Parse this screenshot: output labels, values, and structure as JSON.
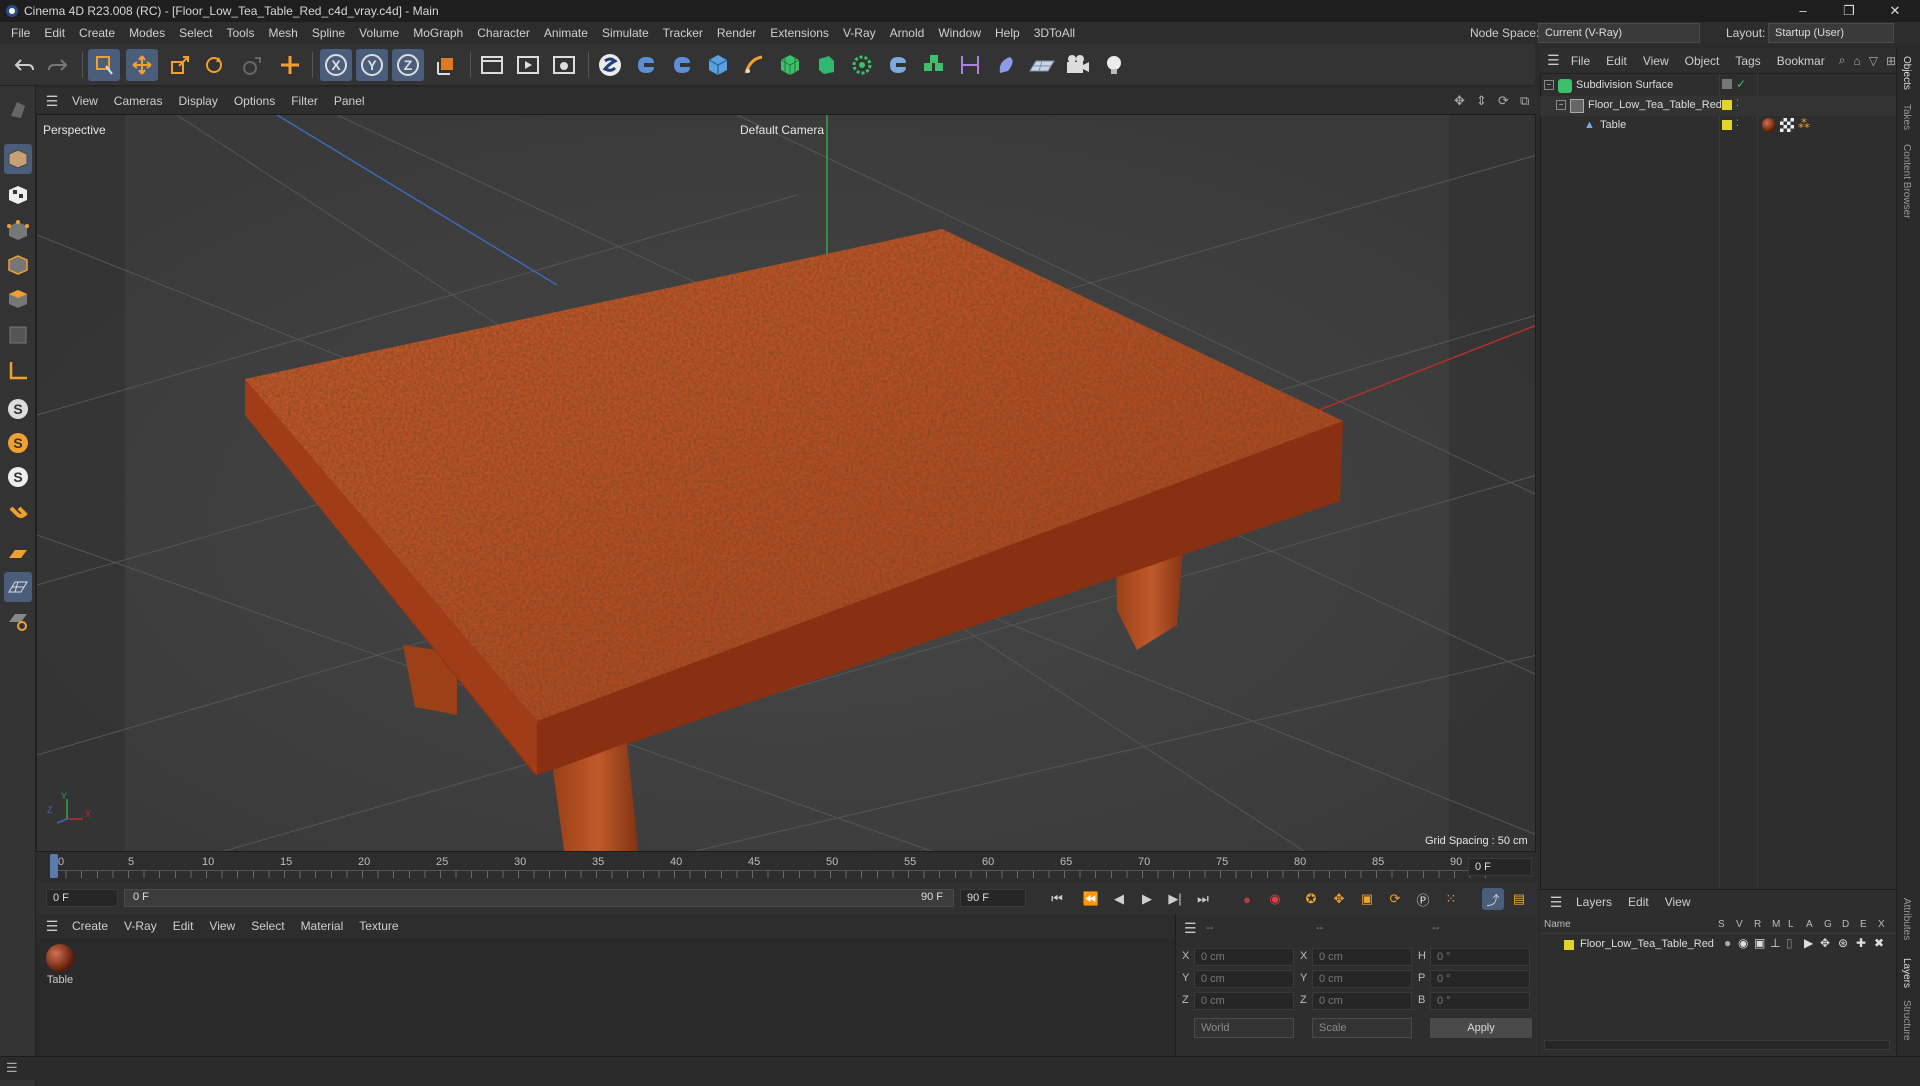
{
  "window": {
    "title": "Cinema 4D R23.008 (RC) - [Floor_Low_Tea_Table_Red_c4d_vray.c4d] - Main",
    "min": "–",
    "restore": "❐",
    "close": "✕"
  },
  "menu": [
    "File",
    "Edit",
    "Create",
    "Modes",
    "Select",
    "Tools",
    "Mesh",
    "Spline",
    "Volume",
    "MoGraph",
    "Character",
    "Animate",
    "Simulate",
    "Tracker",
    "Render",
    "Extensions",
    "V-Ray",
    "Arnold",
    "Window",
    "Help",
    "3DToAll"
  ],
  "nodespace": {
    "label": "Node Space:",
    "value": "Current (V-Ray)"
  },
  "layout": {
    "label": "Layout:",
    "value": "Startup (User)"
  },
  "viewport": {
    "menu": [
      "View",
      "Cameras",
      "Display",
      "Options",
      "Filter",
      "Panel"
    ],
    "name": "Perspective",
    "camera": "Default Camera",
    "grid": "Grid Spacing : 50 cm",
    "axis": {
      "y": "Y",
      "z": "Z",
      "x": "X"
    }
  },
  "timeline": {
    "ticks": [
      "0",
      "5",
      "10",
      "15",
      "20",
      "25",
      "30",
      "35",
      "40",
      "45",
      "50",
      "55",
      "60",
      "65",
      "70",
      "75",
      "80",
      "85",
      "90"
    ],
    "current": "0 F"
  },
  "transport": {
    "start": "0 F",
    "slider_start": "0 F",
    "slider_end": "90 F",
    "end": "90 F"
  },
  "material_manager": {
    "menu": [
      "Create",
      "V-Ray",
      "Edit",
      "View",
      "Select",
      "Material",
      "Texture"
    ],
    "materials": [
      {
        "name": "Table"
      }
    ]
  },
  "coords": {
    "header": [
      "--",
      "--",
      "--"
    ],
    "rows": [
      {
        "a": "X",
        "av": "0 cm",
        "b": "X",
        "bv": "0 cm",
        "c": "H",
        "cv": "0 °"
      },
      {
        "a": "Y",
        "av": "0 cm",
        "b": "Y",
        "bv": "0 cm",
        "c": "P",
        "cv": "0 °"
      },
      {
        "a": "Z",
        "av": "0 cm",
        "b": "Z",
        "bv": "0 cm",
        "c": "B",
        "cv": "0 °"
      }
    ],
    "world": "World",
    "scale": "Scale",
    "apply": "Apply"
  },
  "objects": {
    "menu": [
      "File",
      "Edit",
      "View",
      "Object",
      "Tags",
      "Bookmar"
    ],
    "items": [
      {
        "name": "Subdivision Surface",
        "color": "#9aa0a6"
      },
      {
        "name": "Floor_Low_Tea_Table_Red",
        "color": "#e3d42b"
      },
      {
        "name": "Table",
        "color": "#e3d42b"
      }
    ]
  },
  "layers": {
    "menu": [
      "Layers",
      "Edit",
      "View"
    ],
    "cols": [
      "Name",
      "S",
      "V",
      "R",
      "M",
      "L",
      "A",
      "G",
      "D",
      "E",
      "X"
    ],
    "items": [
      {
        "name": "Floor_Low_Tea_Table_Red",
        "color": "#e3d42b"
      }
    ]
  },
  "side_tabs": [
    "Objects",
    "Takes",
    "Content Browser",
    "Attributes",
    "Layers",
    "Structure"
  ],
  "colors": {
    "accent": "#4a5d7a",
    "table": "#b0431a",
    "yellow": "#e3d42b"
  }
}
